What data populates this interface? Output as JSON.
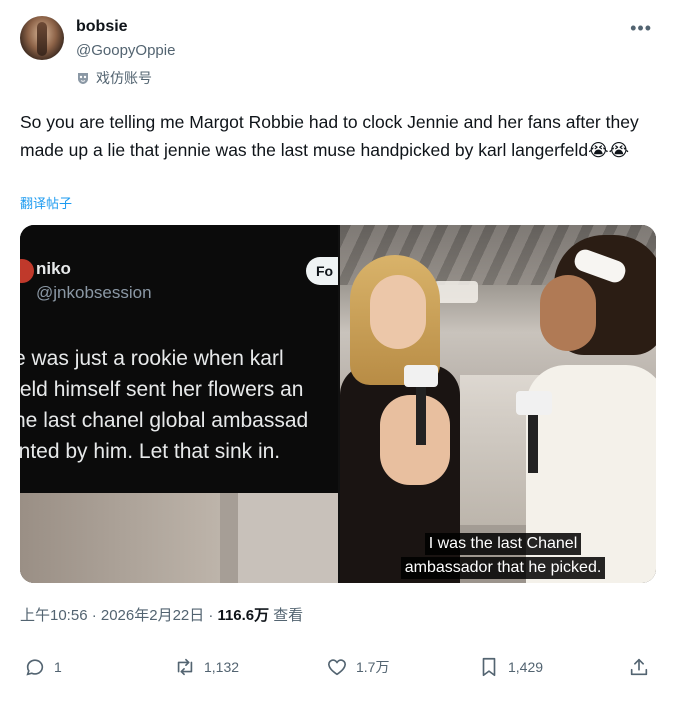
{
  "author": {
    "display_name": "bobsie",
    "handle": "@GoopyOppie",
    "badge_label": "戏仿账号"
  },
  "tweet": {
    "text": "So you are telling me Margot Robbie had to clock Jennie and her fans after they made up a lie that jennie was the last muse handpicked by karl langerfeld😭😭",
    "translate_label": "翻译帖子"
  },
  "media": {
    "left_screenshot": {
      "name": "niko",
      "handle": "@jnkobsession",
      "follow_label": "Fo",
      "lines": [
        "e was just a rookie when karl",
        "feld himself sent her flowers an",
        "he last chanel global ambassad",
        "inted by him. Let that sink in."
      ]
    },
    "right_photo": {
      "subtitle_lines": [
        "I was the last Chanel",
        "ambassador that he picked."
      ]
    }
  },
  "meta": {
    "timestamp": "上午10:56 · 2026年2月22日 ·",
    "views_count": "116.6万",
    "views_label": "查看"
  },
  "actions": {
    "replies": "1",
    "reposts": "1,132",
    "likes": "1.7万",
    "bookmarks": "1,429"
  },
  "icons": {
    "more": "more-options-icon",
    "badge": "parody-mask-icon",
    "reply": "reply-icon",
    "repost": "repost-icon",
    "like": "like-icon",
    "bookmark": "bookmark-icon",
    "share": "share-icon"
  },
  "colors": {
    "link": "#1d9bf0",
    "secondary_text": "#536471",
    "primary_text": "#0f1419"
  }
}
